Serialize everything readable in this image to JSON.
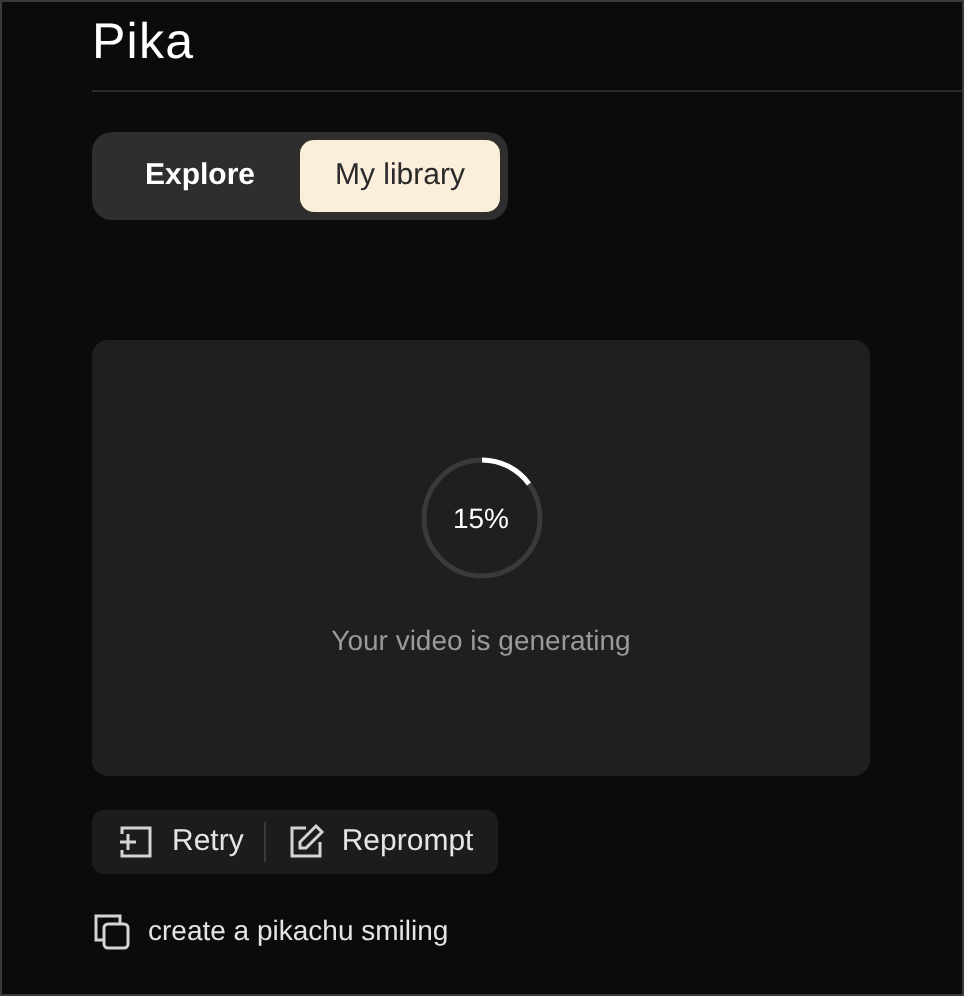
{
  "logo": "Pika",
  "tabs": [
    {
      "label": "Explore",
      "selected": false
    },
    {
      "label": "My library",
      "selected": true
    }
  ],
  "generation": {
    "reading": "15%",
    "status": "Your video is generating"
  },
  "actions": [
    {
      "kind": "retry",
      "label": "Retry"
    },
    {
      "kind": "reprompt",
      "label": "Reprompt"
    }
  ],
  "prompt": "create a pikachu smiling"
}
